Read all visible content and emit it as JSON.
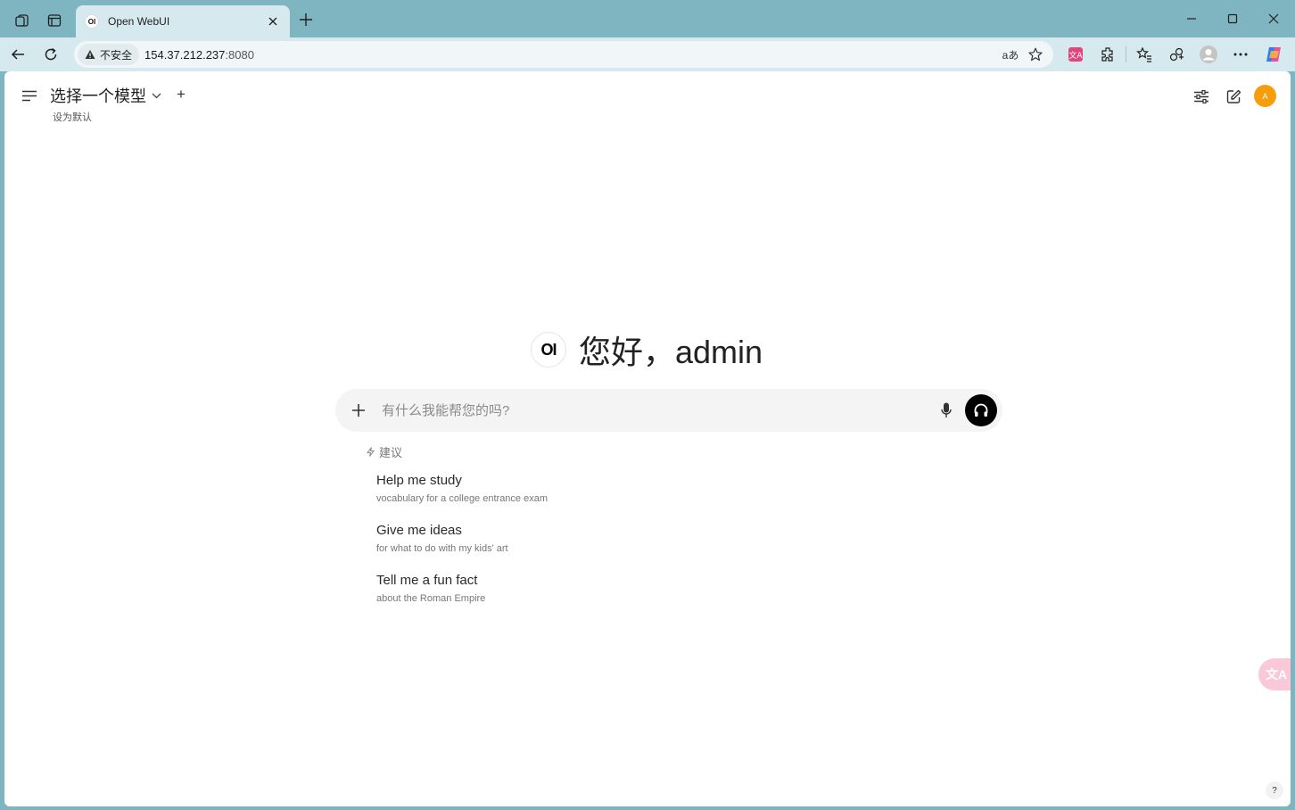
{
  "browser": {
    "tab": {
      "favicon_text": "OI",
      "title": "Open WebUI"
    },
    "address": {
      "security_label": "不安全",
      "host": "154.37.212.237",
      "port": ":8080",
      "read_aloud_glyph": "aあ"
    }
  },
  "header": {
    "model_select_label": "选择一个模型",
    "add_model": "+",
    "set_default": "设为默认",
    "avatar_initial": "A"
  },
  "main": {
    "logo_text": "OI",
    "greeting": "您好，admin",
    "composer": {
      "placeholder": "有什么我能帮您的吗?"
    },
    "suggestions_title": "建议",
    "suggestions": [
      {
        "title": "Help me study",
        "subtitle": "vocabulary for a college entrance exam"
      },
      {
        "title": "Give me ideas",
        "subtitle": "for what to do with my kids' art"
      },
      {
        "title": "Tell me a fun fact",
        "subtitle": "about the Roman Empire"
      }
    ]
  },
  "floating": {
    "translate_glyph": "文A",
    "help": "?"
  },
  "colors": {
    "accent_avatar": "#f59e0b",
    "voice_button": "#000000",
    "browser_frame": "#7fb5c1"
  }
}
